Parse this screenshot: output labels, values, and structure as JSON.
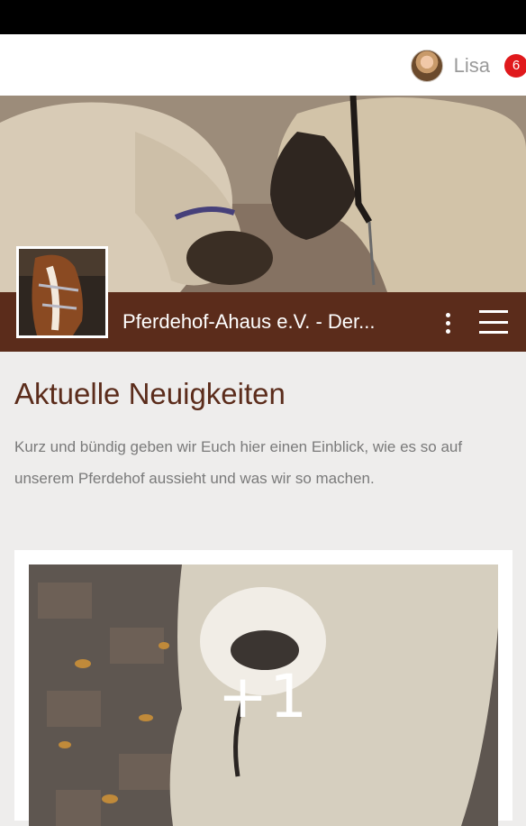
{
  "header": {
    "user_name": "Lisa",
    "notification_count": "6",
    "avatar_icon": "user-avatar-icon"
  },
  "page": {
    "title": "Pferdehof-Ahaus e.V. - Der...",
    "more_icon": "more-vert-icon",
    "menu_icon": "hamburger-menu-icon"
  },
  "content": {
    "heading": "Aktuelle Neuigkeiten",
    "description": "Kurz und bündig geben wir Euch hier einen Einblick, wie es so auf unserem Pferdehof aussieht und was wir so machen."
  },
  "gallery": {
    "overlay_text": "+1"
  },
  "colors": {
    "brand_brown": "#5b2c1b",
    "badge_red": "#e0191c",
    "background": "#eeedec"
  }
}
